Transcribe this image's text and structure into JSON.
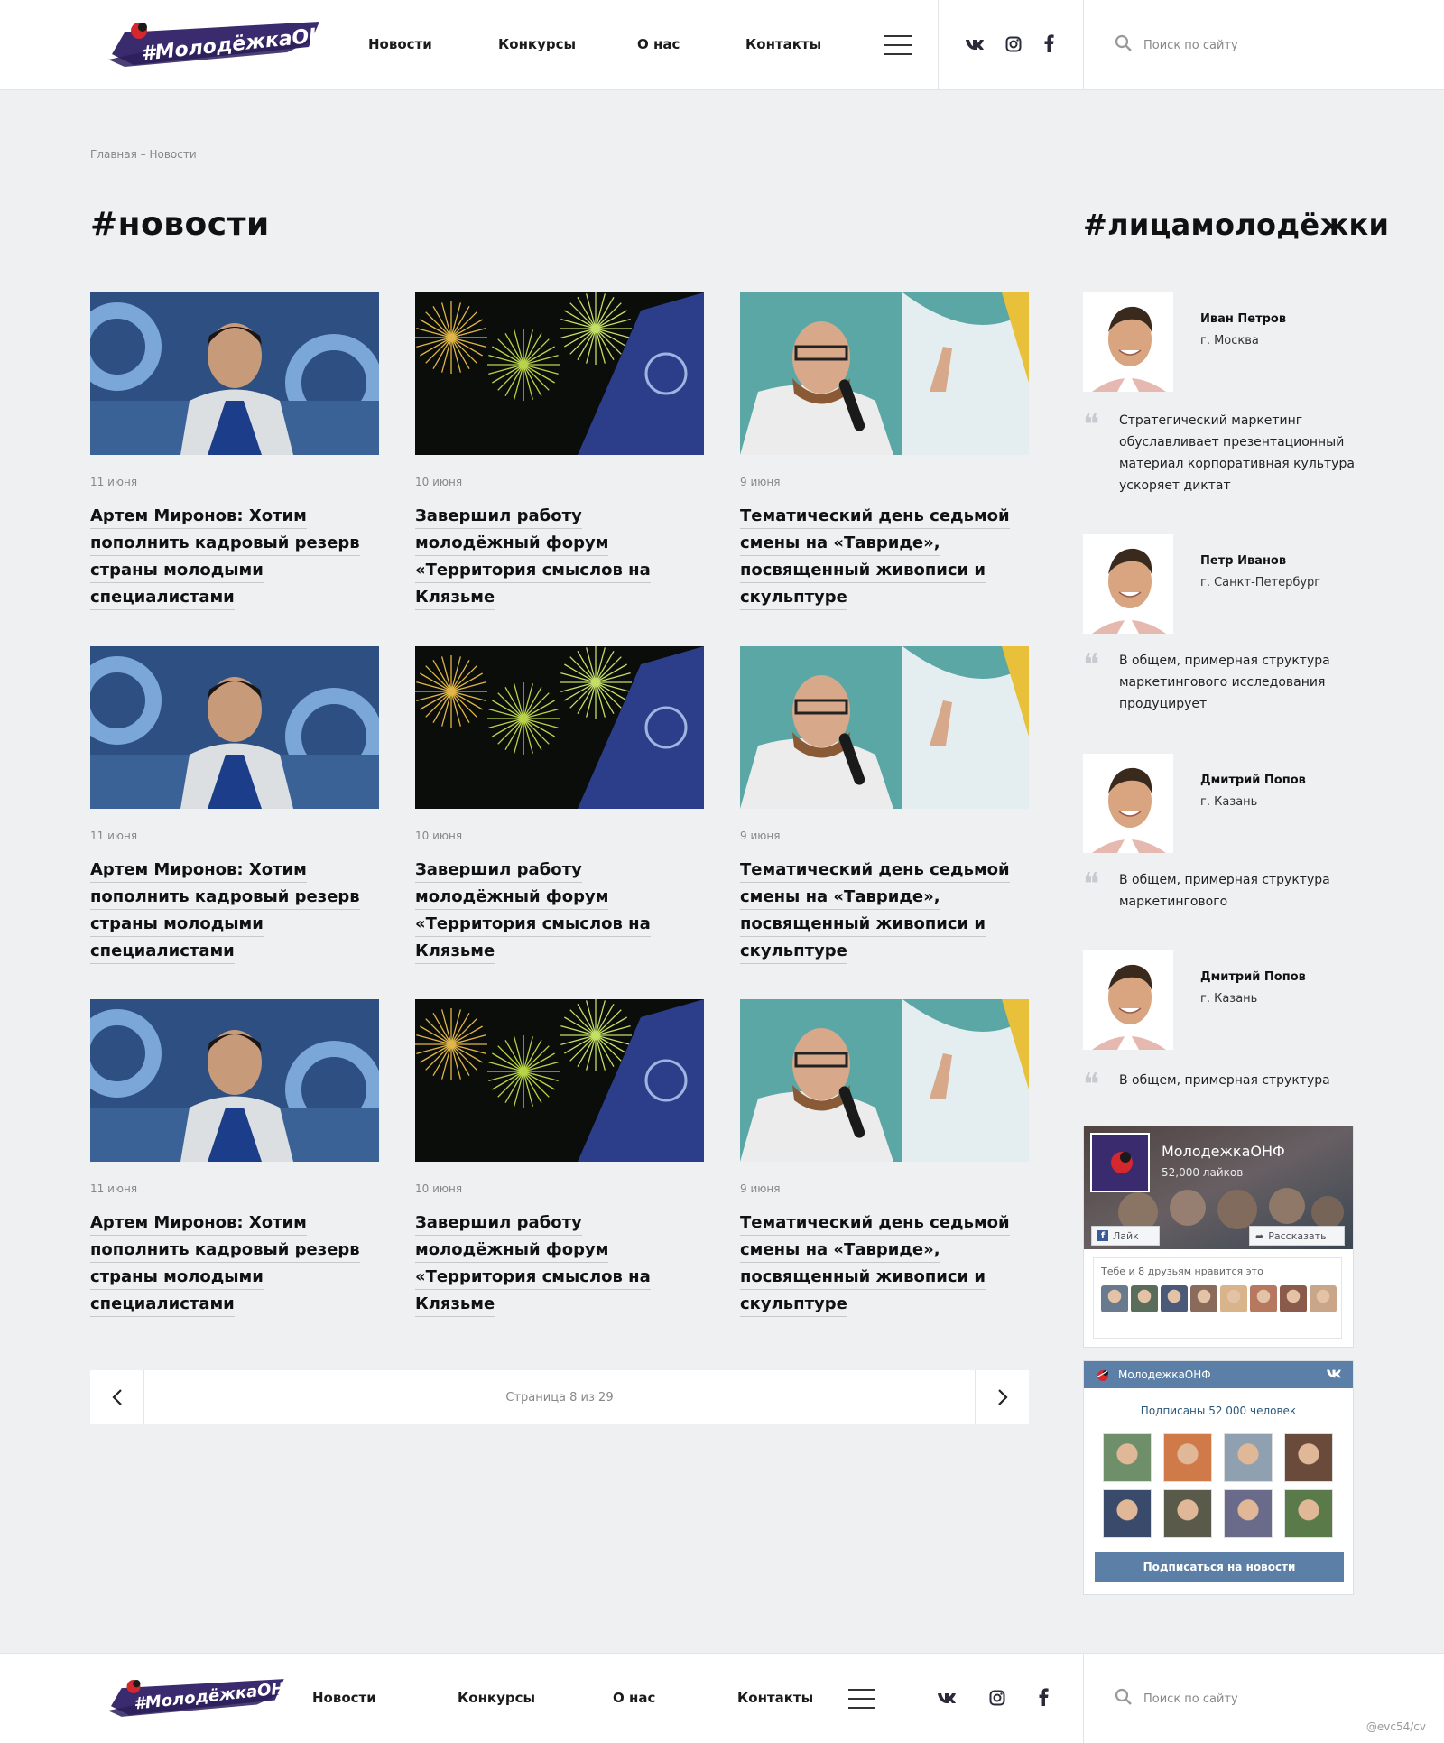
{
  "header": {
    "logo_text": "#МолодёжкаОНФ",
    "nav": [
      "Новости",
      "Конкурсы",
      "О нас",
      "Контакты"
    ],
    "social": [
      "vk-icon",
      "instagram-icon",
      "facebook-icon"
    ],
    "search_placeholder": "Поиск по сайту"
  },
  "breadcrumb": "Главная – Новости",
  "news_title": "#новости",
  "faces_title": "#лицамолодёжки",
  "news": [
    {
      "date": "11 июня",
      "title": "Артем Миронов: Хотим пополнить кадровый резерв страны молодыми специалистами",
      "img": "man-portrait"
    },
    {
      "date": "10 июня",
      "title": "Завершил работу молодёжный форум «Территория смыслов на Клязьме",
      "img": "fireworks"
    },
    {
      "date": "9 июня",
      "title": "Тематический день седьмой смены на «Тавриде», посвященный живописи и скульптуре",
      "img": "speaker"
    },
    {
      "date": "11 июня",
      "title": "Артем Миронов: Хотим пополнить кадровый резерв страны молодыми специалистами",
      "img": "man-portrait"
    },
    {
      "date": "10 июня",
      "title": "Завершил работу молодёжный форум «Территория смыслов на Клязьме",
      "img": "fireworks"
    },
    {
      "date": "9 июня",
      "title": "Тематический день седьмой смены на «Тавриде», посвященный живописи и скульптуре",
      "img": "speaker"
    },
    {
      "date": "11 июня",
      "title": "Артем Миронов: Хотим пополнить кадровый резерв страны молодыми специалистами",
      "img": "man-portrait"
    },
    {
      "date": "10 июня",
      "title": "Завершил работу молодёжный форум «Территория смыслов на Клязьме",
      "img": "fireworks"
    },
    {
      "date": "9 июня",
      "title": "Тематический день седьмой смены на «Тавриде», посвященный живописи и скульптуре",
      "img": "speaker"
    }
  ],
  "people": [
    {
      "name": "Иван Петров",
      "city": "г. Москва",
      "quote": "Стратегический маркетинг обуславливает презентационный материал корпоративная культура ускоряет диктат"
    },
    {
      "name": "Петр Иванов",
      "city": "г. Санкт-Петербург",
      "quote": "В общем, примерная структура маркетингового исследования продуцирует"
    },
    {
      "name": "Дмитрий Попов",
      "city": "г. Казань",
      "quote": "В общем, примерная структура маркетингового"
    },
    {
      "name": "Дмитрий Попов",
      "city": "г. Казань",
      "quote": "В общем, примерная структура"
    }
  ],
  "pagination": {
    "text": "Страница 8 из 29",
    "prev": "‹",
    "next": "›"
  },
  "fb_widget": {
    "name": "МолодежкаОНФ",
    "likes": "52,000 лайков",
    "like_btn": "Лайк",
    "share_btn": "Рассказать",
    "friends_text": "Тебе и 8 друзьям нравится это"
  },
  "vk_widget": {
    "name": "МолодежкаОНФ",
    "subscribers": "Подписаны 52 000 человек",
    "button": "Подписаться на новости"
  },
  "watermark": "@evc54/cv",
  "colors": {
    "accent": "#3a2a6e",
    "vk": "#5b7fa6",
    "bullfinch_red": "#d4282e"
  }
}
